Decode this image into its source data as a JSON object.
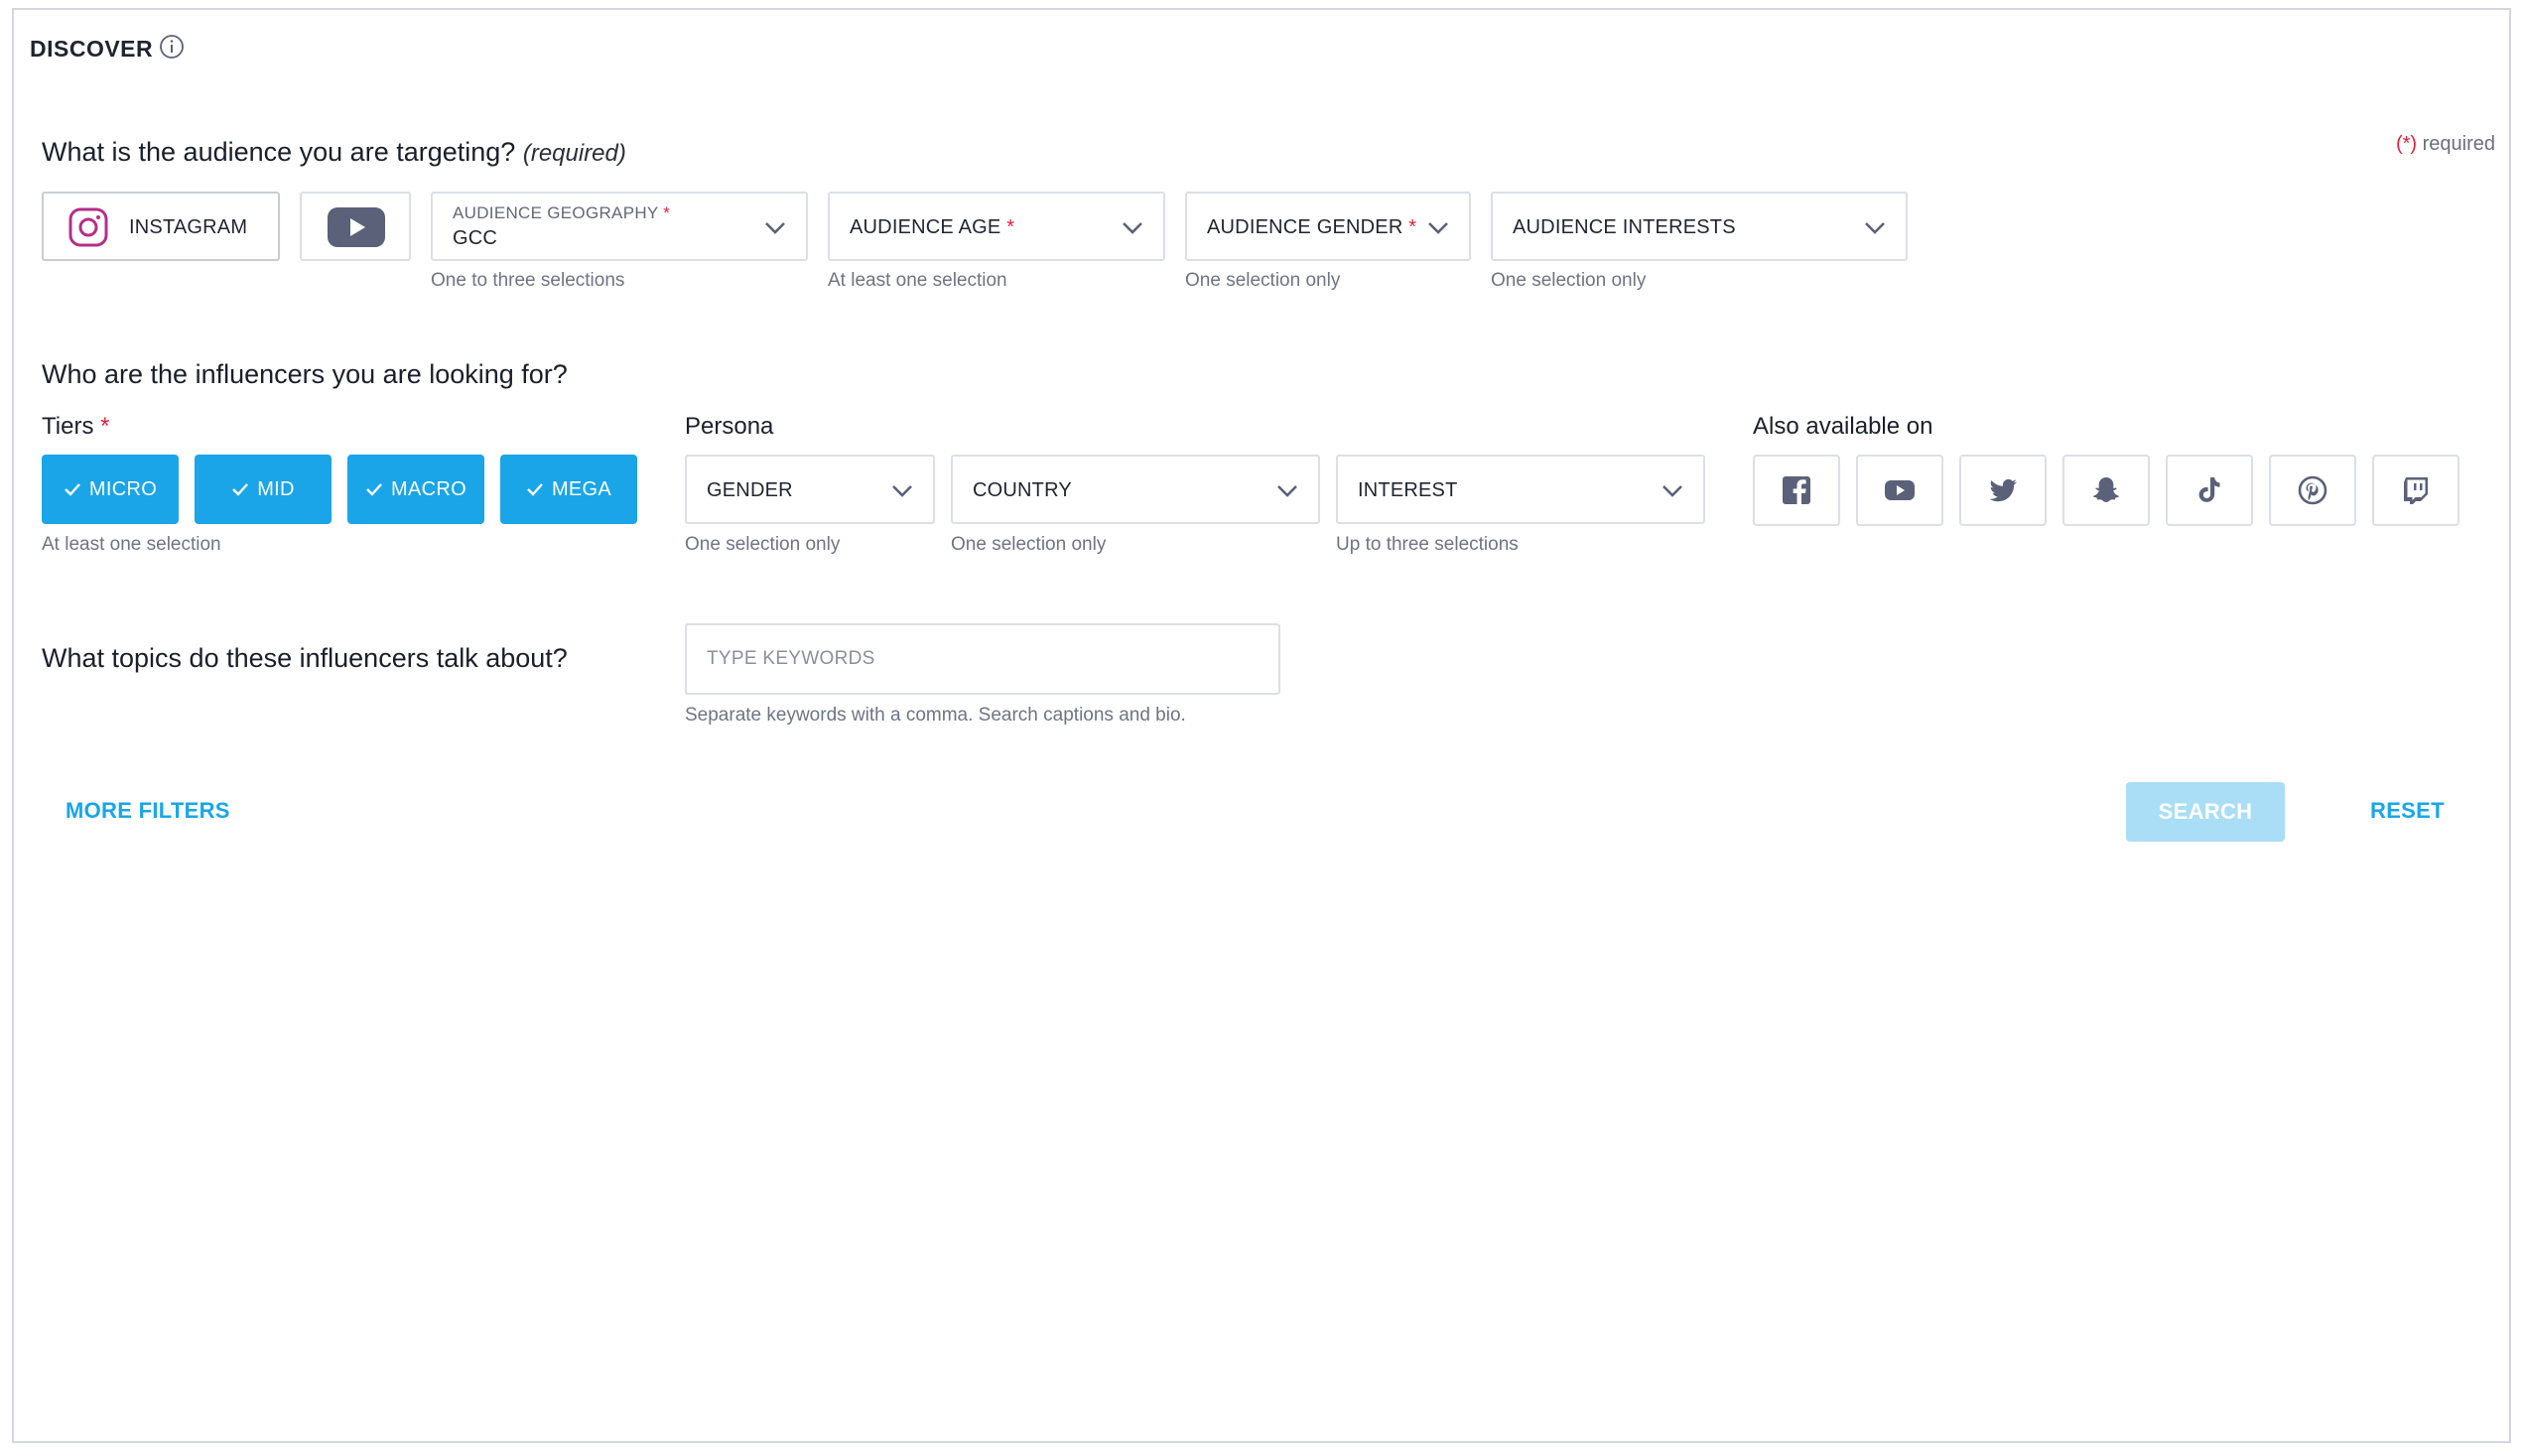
{
  "header": {
    "title": "DISCOVER"
  },
  "audience": {
    "question": "What is the audience you are targeting?",
    "required_tag": "(required)",
    "required_note_star": "(*)",
    "required_note_text": " required",
    "platforms": [
      {
        "label": "INSTAGRAM",
        "icon": "instagram-icon",
        "selected": true
      },
      {
        "label": "",
        "icon": "youtube-icon",
        "selected": false
      }
    ],
    "geography": {
      "label": "AUDIENCE GEOGRAPHY",
      "value": "GCC",
      "hint": "One to three selections"
    },
    "age": {
      "label": "AUDIENCE AGE",
      "hint": "At least one selection"
    },
    "gender": {
      "label": "AUDIENCE GENDER",
      "hint": "One selection only"
    },
    "interests": {
      "label": "AUDIENCE INTERESTS",
      "hint": "One selection only"
    },
    "star": "*"
  },
  "influencers": {
    "question": "Who are the influencers you are looking for?",
    "tiers_label": "Tiers",
    "tiers": [
      "MICRO",
      "MID",
      "MACRO",
      "MEGA"
    ],
    "tiers_hint": "At least one selection",
    "persona_label": "Persona",
    "persona": {
      "gender": {
        "label": "GENDER",
        "hint": "One selection only"
      },
      "country": {
        "label": "COUNTRY",
        "hint": "One selection only"
      },
      "interest": {
        "label": "INTEREST",
        "hint": "Up to three selections"
      }
    },
    "also_label": "Also available on",
    "also_platforms": [
      "facebook-icon",
      "youtube-icon",
      "twitter-icon",
      "snapchat-icon",
      "tiktok-icon",
      "pinterest-icon",
      "twitch-icon"
    ]
  },
  "topics": {
    "question": "What topics do these influencers talk about?",
    "placeholder": "TYPE KEYWORDS",
    "value": "",
    "hint": "Separate keywords with a comma. Search captions and bio."
  },
  "actions": {
    "more_filters": "MORE FILTERS",
    "search": "SEARCH",
    "reset": "RESET"
  },
  "colors": {
    "accent": "#1aa5e8",
    "required": "#e0203b",
    "search_disabled": "#a9def6",
    "icon": "#5b6178"
  }
}
